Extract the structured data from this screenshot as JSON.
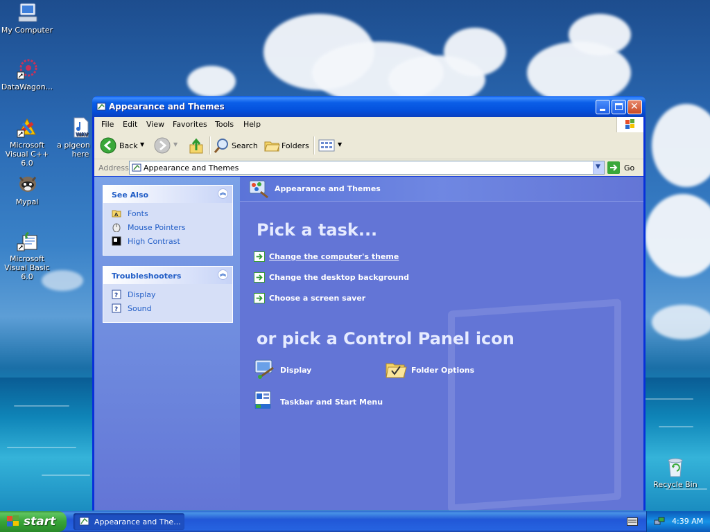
{
  "desktop": {
    "icons": [
      {
        "label": "My Computer"
      },
      {
        "label": "DataWagon..."
      },
      {
        "label": "Microsoft Visual C++ 6.0"
      },
      {
        "label": "a pigeon c... here"
      },
      {
        "label": "Mypal"
      },
      {
        "label": "Microsoft Visual Basic 6.0"
      },
      {
        "label": "Recycle Bin"
      }
    ]
  },
  "window": {
    "title": "Appearance and Themes",
    "menu": [
      "File",
      "Edit",
      "View",
      "Favorites",
      "Tools",
      "Help"
    ],
    "toolbar": {
      "back": "Back",
      "search": "Search",
      "folders": "Folders"
    },
    "address": {
      "label": "Address",
      "value": "Appearance and Themes",
      "go": "Go"
    },
    "see_also": {
      "title": "See Also",
      "items": [
        "Fonts",
        "Mouse Pointers",
        "High Contrast"
      ]
    },
    "troubleshooters": {
      "title": "Troubleshooters",
      "items": [
        "Display",
        "Sound"
      ]
    },
    "main": {
      "header": "Appearance and Themes",
      "pick_task": "Pick a task...",
      "tasks": [
        "Change the computer's theme",
        "Change the desktop background",
        "Choose a screen saver"
      ],
      "pick_icon": "or pick a Control Panel icon",
      "icons": [
        "Display",
        "Folder Options",
        "Taskbar and Start Menu"
      ]
    }
  },
  "taskbar": {
    "start": "start",
    "task_button": "Appearance and The...",
    "clock": "4:39 AM"
  },
  "colors": {
    "title_blue": "#0054e3",
    "pane_blue": "#6375d6",
    "link_blue": "#215dc6",
    "start_green": "#37a437"
  }
}
